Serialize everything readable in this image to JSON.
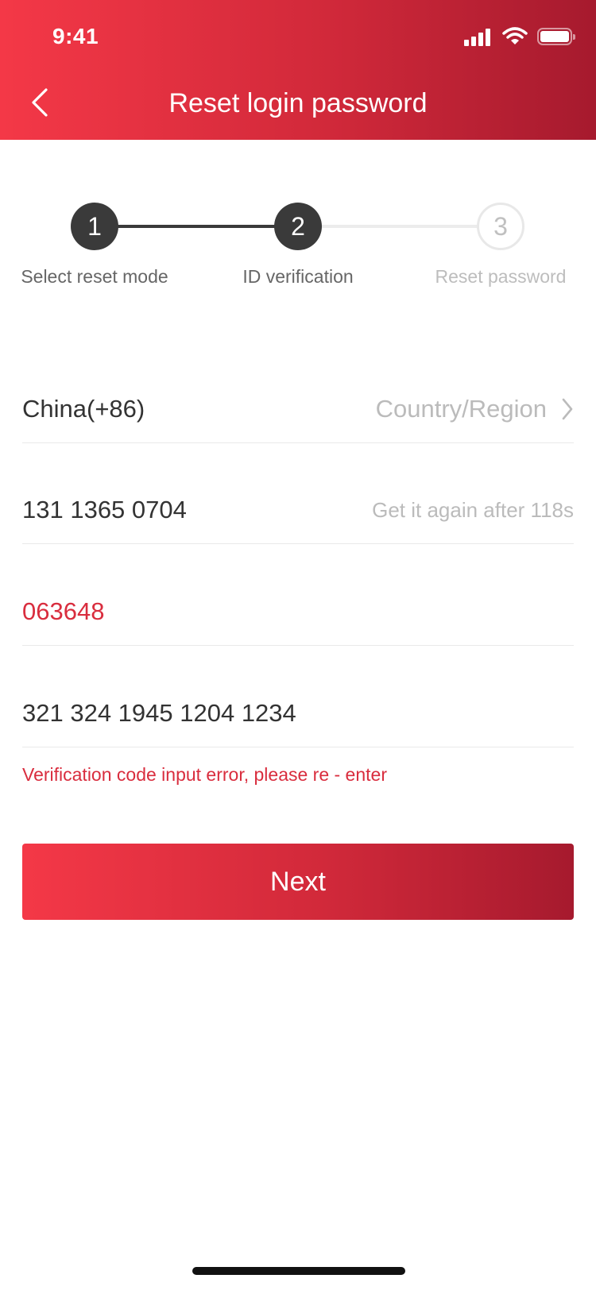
{
  "status_bar": {
    "time": "9:41"
  },
  "header": {
    "title": "Reset login password",
    "back_icon": "chevron-left-icon"
  },
  "stepper": {
    "steps": [
      {
        "number": "1",
        "label": "Select reset mode",
        "state": "done"
      },
      {
        "number": "2",
        "label": "ID verification",
        "state": "done"
      },
      {
        "number": "3",
        "label": "Reset password",
        "state": "todo"
      }
    ]
  },
  "form": {
    "country_value": "China(+86)",
    "country_label": "Country/Region",
    "phone_value": "131 1365 0704",
    "resend_countdown": "Get it again after 118s",
    "verification_code": "063648",
    "id_number": "321 324 1945 1204 1234",
    "error_message": "Verification code input error, please re - enter"
  },
  "actions": {
    "next_label": "Next"
  },
  "colors": {
    "accent_start": "#f43847",
    "accent_end": "#a61a2e",
    "error": "#d92d3e",
    "step_active": "#3a3a3a"
  }
}
